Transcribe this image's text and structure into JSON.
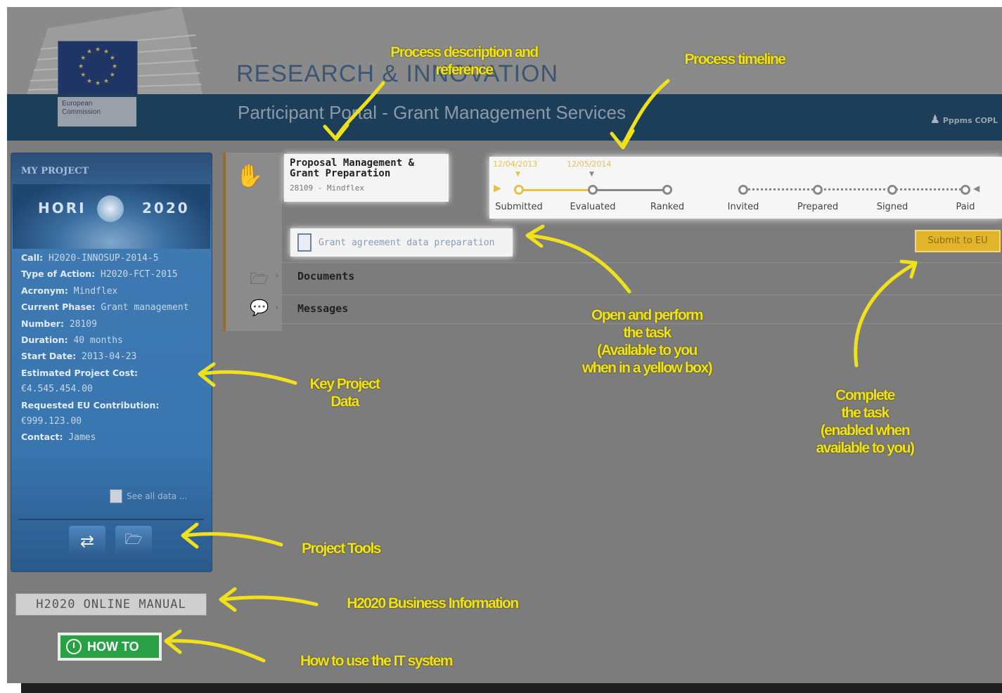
{
  "header": {
    "commission_label": "European Commission",
    "site_title": "RESEARCH & INNOVATION",
    "site_subtitle": "Participant Portal - Grant Management Services",
    "user_name": "Pppms COPL"
  },
  "left_panel": {
    "title": "MY PROJECT",
    "banner_text_left": "HORI",
    "banner_text_right": "2020",
    "fields": [
      {
        "label": "Call:",
        "value": "H2020-INNOSUP-2014-5"
      },
      {
        "label": "Type of Action:",
        "value": "H2020-FCT-2015"
      },
      {
        "label": "Acronym:",
        "value": "Mindflex"
      },
      {
        "label": "Current Phase:",
        "value": "Grant management"
      },
      {
        "label": "Number:",
        "value": "28109"
      },
      {
        "label": "Duration:",
        "value": "40 months"
      },
      {
        "label": "Start Date:",
        "value": "2013-04-23"
      },
      {
        "label": "Estimated Project Cost:",
        "value": "€4.545.454.00"
      },
      {
        "label": "Requested EU Contribution:",
        "value": "€999.123.00"
      },
      {
        "label": "Contact:",
        "value": "James"
      }
    ],
    "see_all_label": "See all data ...",
    "tools": [
      "exchange-icon",
      "folder-icon"
    ]
  },
  "manual_label": "H2020 ONLINE MANUAL",
  "howto_label": "HOW TO",
  "process": {
    "title": "Proposal Management & Grant Preparation",
    "reference": "28109 - Mindflex",
    "timeline": {
      "dates": [
        "12/04/2013",
        "12/05/2014"
      ],
      "stages": [
        "Submitted",
        "Evaluated",
        "Ranked",
        "Invited",
        "Prepared",
        "Signed",
        "Paid"
      ],
      "accent_color": "#e2c24a"
    },
    "task_label": "Grant agreement data preparation",
    "submit_label": "Submit to EU",
    "sections": [
      "Documents",
      "Messages"
    ]
  },
  "annotations": {
    "process_description": "Process description and reference",
    "process_timeline": "Process timeline",
    "open_task": [
      "Open and perform",
      "the task",
      "(Available to you",
      "when in a yellow box)"
    ],
    "complete_task": [
      "Complete",
      "the task",
      "(enabled when",
      "available to you)"
    ],
    "key_project_data": [
      "Key Project",
      "Data"
    ],
    "project_tools": "Project Tools",
    "business_info": "H2020 Business Information",
    "how_to_use": "How to use the IT system",
    "color": "#f1e11a"
  }
}
